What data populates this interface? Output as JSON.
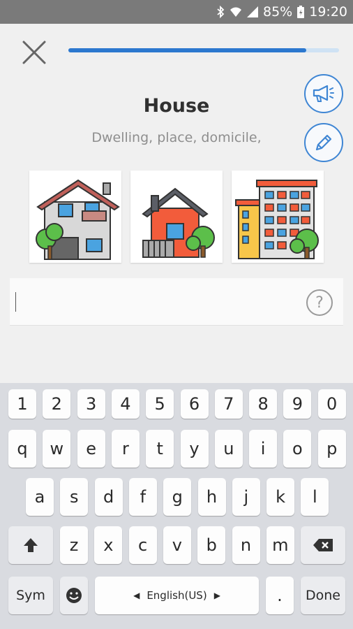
{
  "status_bar": {
    "battery": "85%",
    "time": "19:20",
    "icons": [
      "bluetooth-icon",
      "wifi-icon",
      "signal-icon",
      "battery-icon"
    ]
  },
  "lesson": {
    "progress": 0.88,
    "word": "House",
    "synonyms": "Dwelling, place, domicile,",
    "images": [
      "two-storey-house",
      "small-red-house",
      "apartment-building"
    ]
  },
  "answer": {
    "value": "",
    "placeholder": ""
  },
  "keyboard": {
    "number_row": [
      "1",
      "2",
      "3",
      "4",
      "5",
      "6",
      "7",
      "8",
      "9",
      "0"
    ],
    "row1": [
      "q",
      "w",
      "e",
      "r",
      "t",
      "y",
      "u",
      "i",
      "o",
      "p"
    ],
    "row2": [
      "a",
      "s",
      "d",
      "f",
      "g",
      "h",
      "j",
      "k",
      "l"
    ],
    "row3": [
      "z",
      "x",
      "c",
      "v",
      "b",
      "n",
      "m"
    ],
    "sym_label": "Sym",
    "space_label": "English(US)",
    "period_label": ".",
    "done_label": "Done"
  },
  "colors": {
    "accent": "#2c78cf",
    "status_bar": "#7a7a7a",
    "background": "#f0f0f0",
    "keyboard_bg": "#d9dbe0"
  }
}
